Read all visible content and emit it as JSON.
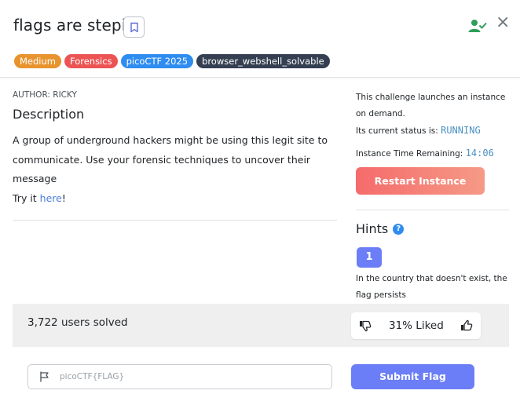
{
  "header": {
    "title": "flags are stepic",
    "close_glyph": "×"
  },
  "tags": [
    {
      "label": "Medium",
      "color": "#e8932e"
    },
    {
      "label": "Forensics",
      "color": "#ec5454"
    },
    {
      "label": "picoCTF 2025",
      "color": "#2f8cf0"
    },
    {
      "label": "browser_webshell_solvable",
      "color": "#343f52"
    }
  ],
  "challenge": {
    "author": "AUTHOR: RICKY",
    "description_heading": "Description",
    "description": "A group of underground hackers might be using this legit site to communicate. Use your forensic techniques to uncover their message",
    "try_prefix": "Try it ",
    "try_link": "here",
    "try_suffix": "!"
  },
  "instance": {
    "launch_text": "This challenge launches an instance on demand.",
    "status_label": "Its current status is: ",
    "status_value": "RUNNING",
    "time_label": "Instance Time Remaining: ",
    "time_value": "14:06",
    "restart_label": "Restart Instance"
  },
  "hints": {
    "heading": "Hints",
    "help_glyph": "?",
    "button_label": "1",
    "text": "In the country that doesn't exist, the flag persists"
  },
  "stats": {
    "solved": "3,722 users solved",
    "liked": "31% Liked"
  },
  "flag": {
    "placeholder": "picoCTF{FLAG}",
    "value": "",
    "submit_label": "Submit Flag"
  },
  "colors": {
    "accent": "#6b7ef7",
    "restart": "#f56b6b",
    "status": "#4a90c2",
    "user_check": "#2e9e5b"
  },
  "icons": [
    "bookmark-icon",
    "user-check-icon",
    "close-icon",
    "help-icon",
    "thumb-down-icon",
    "thumb-up-icon",
    "flag-icon"
  ]
}
